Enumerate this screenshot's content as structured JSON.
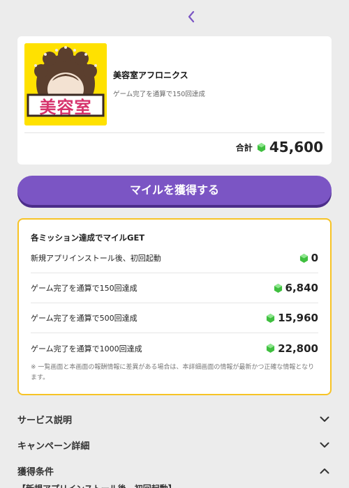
{
  "app": {
    "name": "美容室アフロニクス",
    "logo_text": "美容室",
    "subtitle": "ゲーム完了を通算で150回達成",
    "total_label": "合計",
    "total_value": "45,600"
  },
  "cta": {
    "label": "マイルを獲得する"
  },
  "missions": {
    "title": "各ミッション達成でマイルGET",
    "rows": [
      {
        "label": "新規アプリインストール後、初回起動",
        "value": "0"
      },
      {
        "label": "ゲーム完了を通算で150回達成",
        "value": "6,840"
      },
      {
        "label": "ゲーム完了を通算で500回達成",
        "value": "15,960"
      },
      {
        "label": "ゲーム完了を通算で1000回達成",
        "value": "22,800"
      }
    ],
    "note": "※ 一覧画面と本画面の報酬情報に差異がある場合は、本詳細画面の情報が最新かつ正確な情報となります。"
  },
  "sections": [
    {
      "label": "サービス説明",
      "icon": "chevron-down-icon"
    },
    {
      "label": "キャンペーン詳細",
      "icon": "chevron-down-icon"
    },
    {
      "label": "獲得条件",
      "icon": "chevron-up-icon"
    }
  ],
  "condition_text": "【新規アプリインストール後、初回起動】",
  "colors": {
    "accent": "#7b55c4",
    "border": "#f7c325",
    "logo_bg": "#ffe100",
    "gem": "#3fbf3f"
  }
}
